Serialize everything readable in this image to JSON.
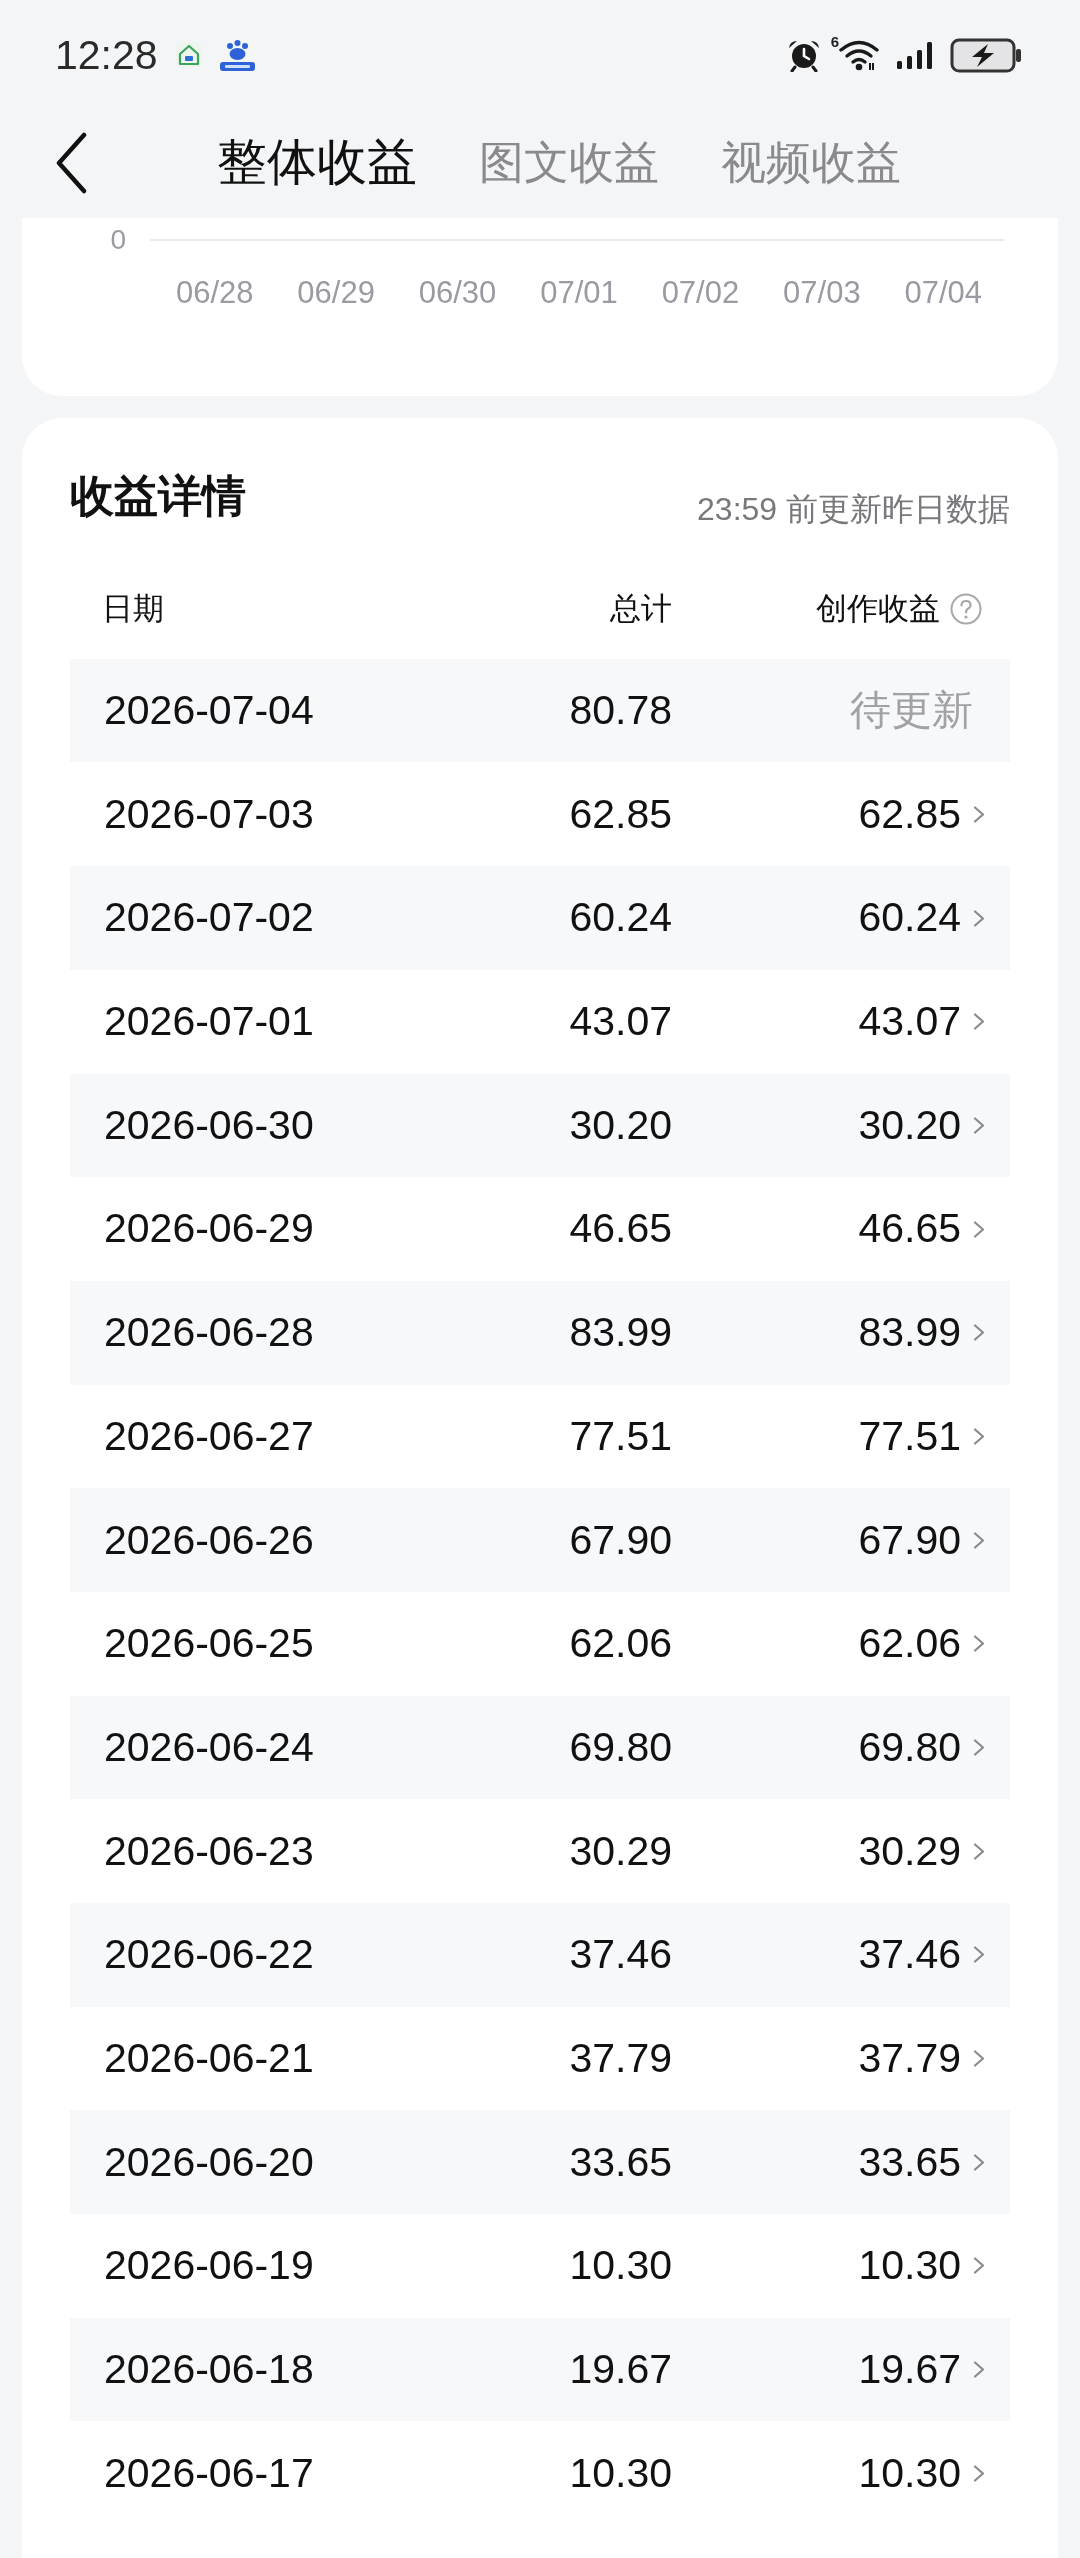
{
  "status_bar": {
    "time": "12:28",
    "network_label": "6"
  },
  "nav": {
    "tabs": [
      {
        "label": "整体收益",
        "selected": true
      },
      {
        "label": "图文收益",
        "selected": false
      },
      {
        "label": "视频收益",
        "selected": false
      }
    ]
  },
  "chart": {
    "y_tick": "0",
    "x_labels": [
      "06/28",
      "06/29",
      "06/30",
      "07/01",
      "07/02",
      "07/03",
      "07/04"
    ]
  },
  "details": {
    "title": "收益详情",
    "note": "23:59 前更新昨日数据",
    "columns": [
      "日期",
      "总计",
      "创作收益"
    ],
    "rows": [
      {
        "date": "2026-07-04",
        "total": "80.78",
        "creation": "待更新",
        "kind": "pending"
      },
      {
        "date": "2026-07-03",
        "total": "62.85",
        "creation": "62.85",
        "kind": "settled"
      },
      {
        "date": "2026-07-02",
        "total": "60.24",
        "creation": "60.24",
        "kind": "settled"
      },
      {
        "date": "2026-07-01",
        "total": "43.07",
        "creation": "43.07",
        "kind": "settled"
      },
      {
        "date": "2026-06-30",
        "total": "30.20",
        "creation": "30.20",
        "kind": "settled"
      },
      {
        "date": "2026-06-29",
        "total": "46.65",
        "creation": "46.65",
        "kind": "settled"
      },
      {
        "date": "2026-06-28",
        "total": "83.99",
        "creation": "83.99",
        "kind": "settled"
      },
      {
        "date": "2026-06-27",
        "total": "77.51",
        "creation": "77.51",
        "kind": "settled"
      },
      {
        "date": "2026-06-26",
        "total": "67.90",
        "creation": "67.90",
        "kind": "settled"
      },
      {
        "date": "2026-06-25",
        "total": "62.06",
        "creation": "62.06",
        "kind": "settled"
      },
      {
        "date": "2026-06-24",
        "total": "69.80",
        "creation": "69.80",
        "kind": "settled"
      },
      {
        "date": "2026-06-23",
        "total": "30.29",
        "creation": "30.29",
        "kind": "settled"
      },
      {
        "date": "2026-06-22",
        "total": "37.46",
        "creation": "37.46",
        "kind": "settled"
      },
      {
        "date": "2026-06-21",
        "total": "37.79",
        "creation": "37.79",
        "kind": "settled"
      },
      {
        "date": "2026-06-20",
        "total": "33.65",
        "creation": "33.65",
        "kind": "settled"
      },
      {
        "date": "2026-06-19",
        "total": "10.30",
        "creation": "10.30",
        "kind": "settled"
      },
      {
        "date": "2026-06-18",
        "total": "19.67",
        "creation": "19.67",
        "kind": "settled"
      },
      {
        "date": "2026-06-17",
        "total": "10.30",
        "creation": "10.30",
        "kind": "settled"
      }
    ]
  }
}
